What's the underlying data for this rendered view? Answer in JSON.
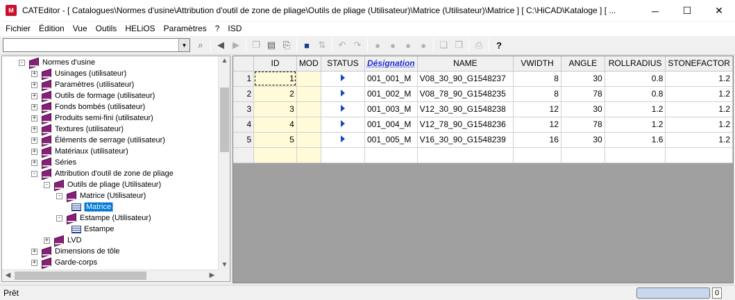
{
  "window": {
    "title": "CATEditor - [ Catalogues\\Normes d'usine\\Attribution d'outil de zone de pliage\\Outils de pliage (Utilisateur)\\Matrice (Utilisateur)\\Matrice ]     [ C:\\HiCAD\\Kataloge ]  [ ...",
    "app_icon_text": "M",
    "minimize": "─",
    "maximize": "☐",
    "close": "✕"
  },
  "menu": {
    "items": [
      "Fichier",
      "Édition",
      "Vue",
      "Outils",
      "HELiOS",
      "Paramètres",
      "?",
      "ISD"
    ]
  },
  "toolbar": {
    "combo_value": "",
    "icons": [
      "binoculars-icon",
      "back-icon",
      "forward-icon",
      "copy-icon",
      "page-icon",
      "new-page-icon",
      "save-icon",
      "sort-icon",
      "undo-icon",
      "redo-icon",
      "add-row-icon",
      "add-row2-icon",
      "add-row3-icon",
      "delete-row-icon",
      "copy-row-icon",
      "paste-row-icon",
      "print-icon",
      "help-icon"
    ]
  },
  "tree": {
    "items": [
      {
        "label": "Normes d'usine",
        "level": 1,
        "expander": "-",
        "icon": "book"
      },
      {
        "label": "Usinages (utilisateur)",
        "level": 2,
        "expander": "+",
        "icon": "book"
      },
      {
        "label": "Paramètres (utilisateur)",
        "level": 2,
        "expander": "+",
        "icon": "book"
      },
      {
        "label": "Outils de formage (utilisateur)",
        "level": 2,
        "expander": "+",
        "icon": "book"
      },
      {
        "label": "Fonds bombés (utilisateur)",
        "level": 2,
        "expander": "+",
        "icon": "book"
      },
      {
        "label": "Produits semi-fini (utilisateur)",
        "level": 2,
        "expander": "+",
        "icon": "book"
      },
      {
        "label": "Textures (utilisateur)",
        "level": 2,
        "expander": "+",
        "icon": "book"
      },
      {
        "label": "Éléments de serrage (utilisateur)",
        "level": 2,
        "expander": "+",
        "icon": "book"
      },
      {
        "label": "Matériaux (utilisateur)",
        "level": 2,
        "expander": "+",
        "icon": "book"
      },
      {
        "label": "Séries",
        "level": 2,
        "expander": "+",
        "icon": "book"
      },
      {
        "label": "Attribution d'outil de zone de pliage",
        "level": 2,
        "expander": "-",
        "icon": "book"
      },
      {
        "label": "Outils de pliage (Utilisateur)",
        "level": 3,
        "expander": "-",
        "icon": "book"
      },
      {
        "label": "Matrice (Utilisateur)",
        "level": 4,
        "expander": "-",
        "icon": "book"
      },
      {
        "label": "Matrice",
        "level": 5,
        "expander": "",
        "icon": "table",
        "selected": true
      },
      {
        "label": "Estampe (Utilisateur)",
        "level": 4,
        "expander": "-",
        "icon": "book"
      },
      {
        "label": "Estampe",
        "level": 5,
        "expander": "",
        "icon": "table"
      },
      {
        "label": "LVD",
        "level": 3,
        "expander": "+",
        "icon": "book"
      },
      {
        "label": "Dimensions de tôle",
        "level": 2,
        "expander": "+",
        "icon": "book"
      },
      {
        "label": "Garde-corps",
        "level": 2,
        "expander": "+",
        "icon": "book"
      }
    ]
  },
  "grid": {
    "columns": [
      "ID",
      "MOD",
      "STATUS",
      "Désignation",
      "NAME",
      "VWIDTH",
      "ANGLE",
      "ROLLRADIUS",
      "STONEFACTOR"
    ],
    "rows": [
      {
        "n": "1",
        "ID": "1",
        "MOD": "",
        "DES": "001_001_M",
        "NAME": "V08_30_90_G1548237",
        "VWIDTH": "8",
        "ANGLE": "30",
        "ROLLRADIUS": "0.8",
        "STONEFACTOR": "1.2"
      },
      {
        "n": "2",
        "ID": "2",
        "MOD": "",
        "DES": "001_002_M",
        "NAME": "V08_78_90_G1548235",
        "VWIDTH": "8",
        "ANGLE": "78",
        "ROLLRADIUS": "0.8",
        "STONEFACTOR": "1.2"
      },
      {
        "n": "3",
        "ID": "3",
        "MOD": "",
        "DES": "001_003_M",
        "NAME": "V12_30_90_G1548238",
        "VWIDTH": "12",
        "ANGLE": "30",
        "ROLLRADIUS": "1.2",
        "STONEFACTOR": "1.2"
      },
      {
        "n": "4",
        "ID": "4",
        "MOD": "",
        "DES": "001_004_M",
        "NAME": "V12_78_90_G1548236",
        "VWIDTH": "12",
        "ANGLE": "78",
        "ROLLRADIUS": "1.2",
        "STONEFACTOR": "1.2"
      },
      {
        "n": "5",
        "ID": "5",
        "MOD": "",
        "DES": "001_005_M",
        "NAME": "V16_30_90_G1548239",
        "VWIDTH": "16",
        "ANGLE": "30",
        "ROLLRADIUS": "1.6",
        "STONEFACTOR": "1.2"
      }
    ]
  },
  "status": {
    "text": "Prêt",
    "count": "0"
  }
}
